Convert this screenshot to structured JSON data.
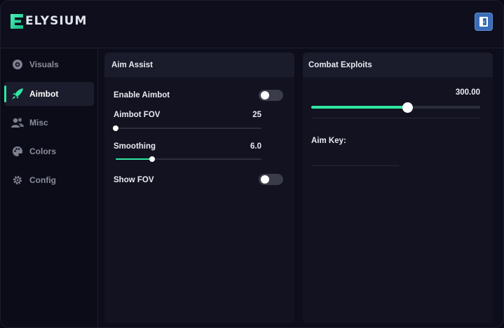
{
  "app": {
    "logo_text": "ELYSIUM",
    "logo_mark": "E",
    "accent_color": "#2ee6a0"
  },
  "header": {
    "exit_icon": "exit-door-icon"
  },
  "sidebar": {
    "items": [
      {
        "label": "Visuals",
        "icon": "eye-icon",
        "active": false
      },
      {
        "label": "Aimbot",
        "icon": "rocket-icon",
        "active": true
      },
      {
        "label": "Misc",
        "icon": "users-icon",
        "active": false
      },
      {
        "label": "Colors",
        "icon": "palette-icon",
        "active": false
      },
      {
        "label": "Config",
        "icon": "gear-icon",
        "active": false
      }
    ]
  },
  "aim_assist": {
    "title": "Aim Assist",
    "enable_aimbot": {
      "label": "Enable Aimbot",
      "on": false
    },
    "aimbot_fov": {
      "label": "Aimbot FOV",
      "value": "25",
      "fraction": 0.0
    },
    "smoothing": {
      "label": "Smoothing",
      "value": "6.0",
      "fraction": 0.25
    },
    "show_fov": {
      "label": "Show FOV",
      "on": false
    }
  },
  "combat_exploits": {
    "title": "Combat Exploits",
    "slider": {
      "value": "300.00",
      "fraction": 0.57
    },
    "aim_key": {
      "label": "Aim Key:",
      "value": ""
    }
  }
}
